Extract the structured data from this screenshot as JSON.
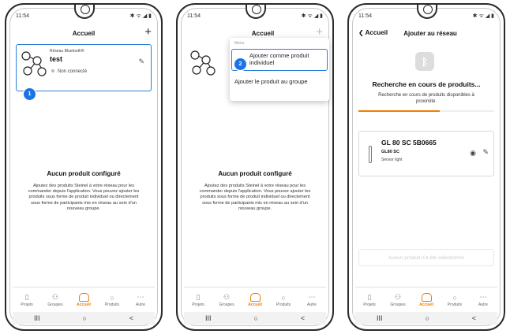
{
  "status_time": "11:54",
  "status_icons": "✱ ᯤ ◢ ▮",
  "screen1": {
    "title": "Accueil",
    "plus": "+",
    "network_label": "Réseau Bluetooth®",
    "network_name": "test",
    "network_status": "Non connecté",
    "empty_title": "Aucun produit configuré",
    "empty_text": "Ajoutez des produits Steinel à votre réseau pour les commander depuis l'application. Vous pouvez ajouter les produits sous forme de produit individuel ou directement sous forme de participants mis en réseau au sein d'un nouveau groupe."
  },
  "screen2": {
    "menu_label": "Menu",
    "menu_item1": "Ajouter comme produit individuel",
    "menu_item2": "Ajouter le produit au groupe"
  },
  "screen3": {
    "back": "Accueil",
    "title": "Ajouter au réseau",
    "search_title": "Recherche en cours de produits...",
    "search_sub": "Recherche en cours de produits disponibles à proximité.",
    "progress": 0.6,
    "product_name": "GL 80 SC 5B0665",
    "product_model": "GL80 SC",
    "product_type": "Sensor light",
    "button": "Aucun produit n'a été sélectionné"
  },
  "badges": [
    "1",
    "2"
  ],
  "tabs": [
    "Projets",
    "Groupes",
    "Accueil",
    "Produits",
    "Autre"
  ],
  "nav": [
    "III",
    "○",
    "<"
  ],
  "colors": {
    "accent": "#f07d00",
    "highlight": "#2a7fd4",
    "badge": "#1a73e8"
  }
}
